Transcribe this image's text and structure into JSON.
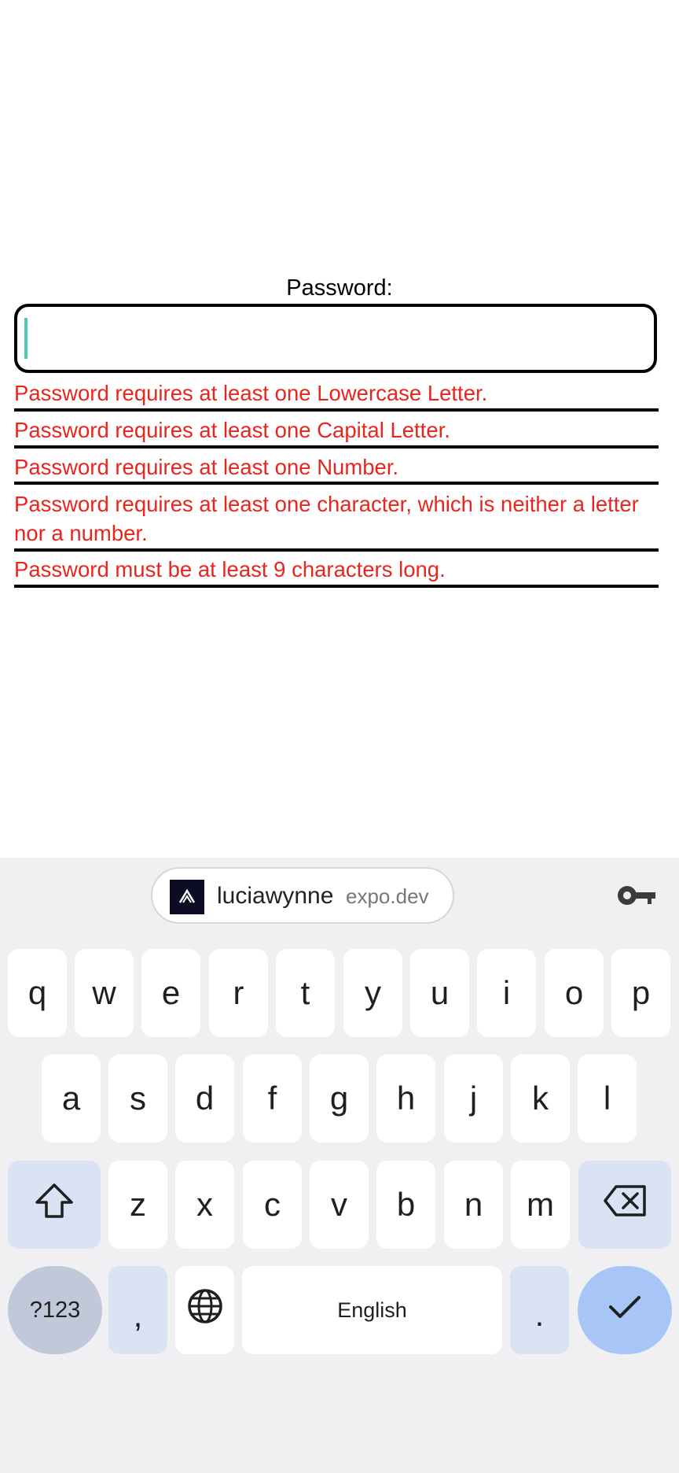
{
  "form": {
    "label": "Password:",
    "input_value": "",
    "errors": [
      "Password requires at least one Lowercase Letter.",
      "Password requires at least one Capital Letter.",
      "Password requires at least one Number.",
      "Password requires at least one character, which is neither a letter nor a number.",
      "Password must be at least 9 characters long."
    ]
  },
  "keyboard": {
    "suggestion": {
      "username": "luciawynne",
      "domain": "expo.dev"
    },
    "row1": [
      "q",
      "w",
      "e",
      "r",
      "t",
      "y",
      "u",
      "i",
      "o",
      "p"
    ],
    "row2": [
      "a",
      "s",
      "d",
      "f",
      "g",
      "h",
      "j",
      "k",
      "l"
    ],
    "row3": [
      "z",
      "x",
      "c",
      "v",
      "b",
      "n",
      "m"
    ],
    "symbols_label": "?123",
    "comma_label": ",",
    "space_label": "English",
    "period_label": ".",
    "icons": {
      "shift": "shift-icon",
      "backspace": "backspace-icon",
      "globe": "globe-icon",
      "enter": "checkmark-icon",
      "key": "key-icon"
    },
    "colors": {
      "accent": "#a7c6f7",
      "error": "#e8251e",
      "caret": "#48c9b0"
    }
  }
}
